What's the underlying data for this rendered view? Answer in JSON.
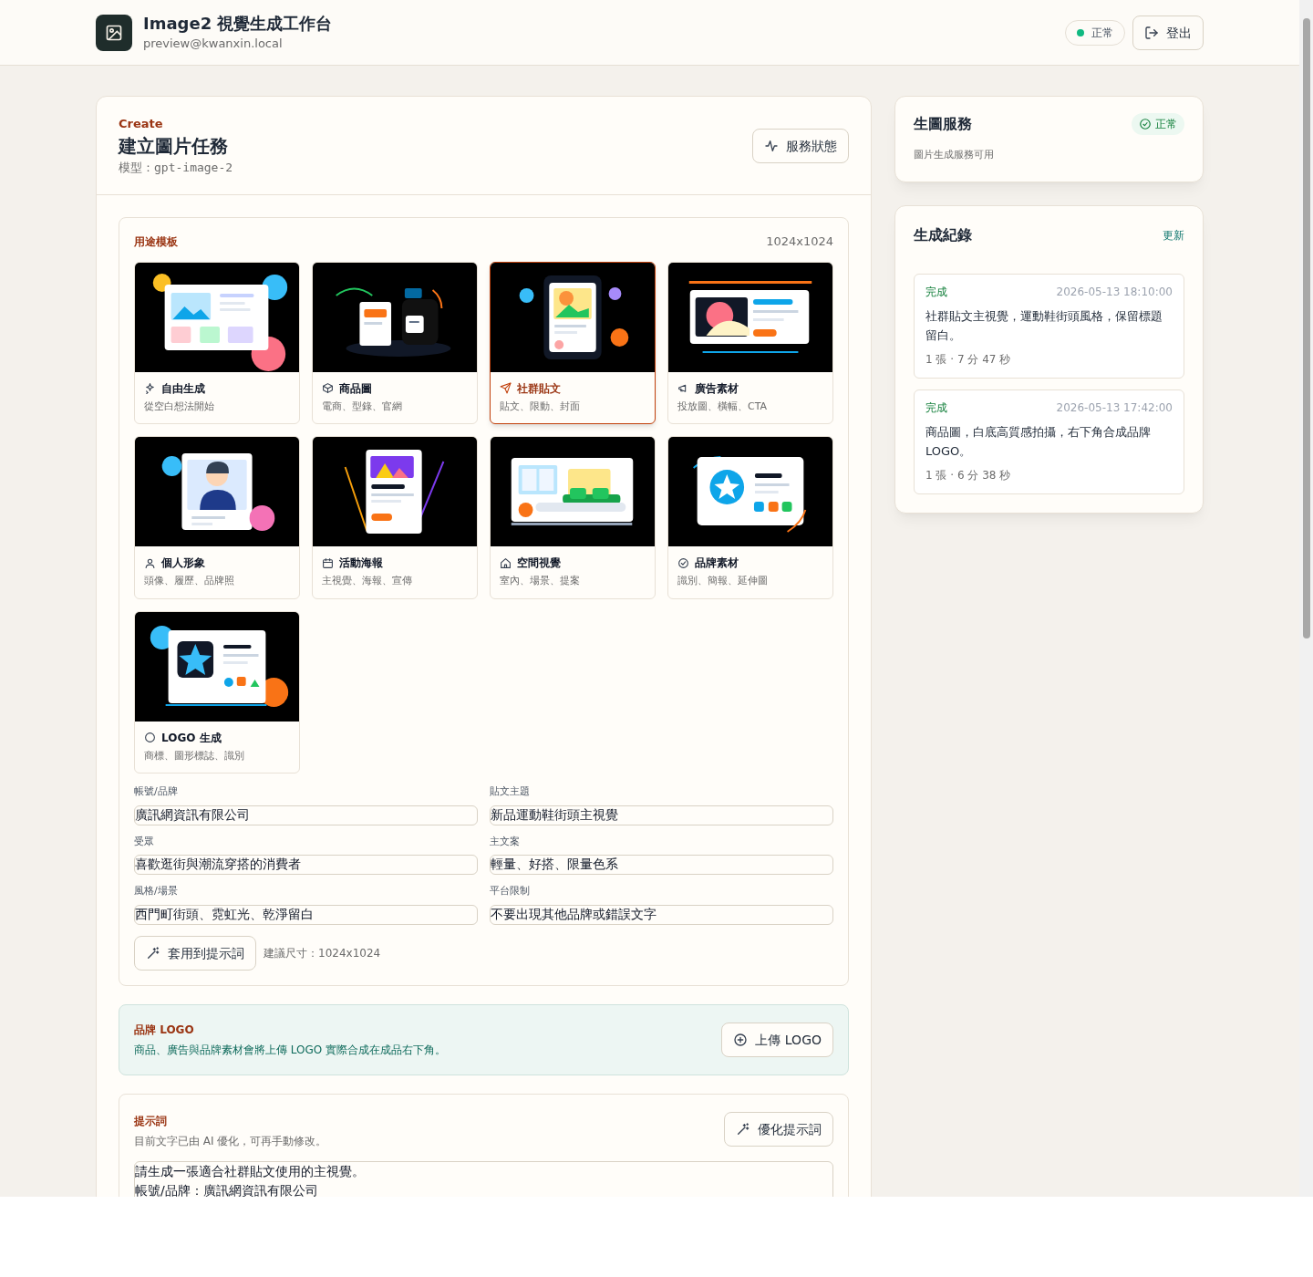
{
  "header": {
    "title": "Image2 視覺生成工作台",
    "email": "preview@kwanxin.local",
    "status": "正常",
    "logout": "登出"
  },
  "create": {
    "eyebrow": "Create",
    "title": "建立圖片任務",
    "model_label": "模型：",
    "model": "gpt-image-2",
    "status_button": "服務狀態"
  },
  "templates": {
    "title": "用途模板",
    "size": "1024x1024",
    "items": [
      {
        "kind": "free",
        "title": "自由生成",
        "subtitle": "從空白想法開始",
        "selected": false
      },
      {
        "kind": "product",
        "title": "商品圖",
        "subtitle": "電商、型錄、官網",
        "selected": false
      },
      {
        "kind": "social",
        "title": "社群貼文",
        "subtitle": "貼文、限動、封面",
        "selected": true
      },
      {
        "kind": "ad",
        "title": "廣告素材",
        "subtitle": "投放圖、橫幅、CTA",
        "selected": false
      },
      {
        "kind": "portrait",
        "title": "個人形象",
        "subtitle": "頭像、履歷、品牌照",
        "selected": false
      },
      {
        "kind": "poster",
        "title": "活動海報",
        "subtitle": "主視覺、海報、宣傳",
        "selected": false
      },
      {
        "kind": "space",
        "title": "空間視覺",
        "subtitle": "室內、場景、提案",
        "selected": false
      },
      {
        "kind": "brand",
        "title": "品牌素材",
        "subtitle": "識別、簡報、延伸圖",
        "selected": false
      },
      {
        "kind": "logo",
        "title": "LOGO 生成",
        "subtitle": "商標、圖形標誌、識別",
        "selected": false
      }
    ]
  },
  "fields": [
    {
      "label": "帳號/品牌",
      "value": "廣訊網資訊有限公司"
    },
    {
      "label": "貼文主題",
      "value": "新品運動鞋街頭主視覺"
    },
    {
      "label": "受眾",
      "value": "喜歡逛街與潮流穿搭的消費者"
    },
    {
      "label": "主文案",
      "value": "輕量、好搭、限量色系"
    },
    {
      "label": "風格/場景",
      "value": "西門町街頭、霓虹光、乾淨留白"
    },
    {
      "label": "平台限制",
      "value": "不要出現其他品牌或錯誤文字"
    }
  ],
  "apply_button": "套用到提示詞",
  "suggested_size": "建議尺寸：1024x1024",
  "brand_logo": {
    "title": "品牌 LOGO",
    "description": "商品、廣告與品牌素材會將上傳 LOGO 實際合成在成品右下角。",
    "button": "上傳 LOGO"
  },
  "prompt": {
    "title": "提示詞",
    "note": "目前文字已由 AI 優化，可再手動修改。",
    "button": "優化提示詞",
    "lines": [
      "請生成一張適合社群貼文使用的主視覺。",
      "帳號/品牌：廣訊網資訊有限公司"
    ]
  },
  "service": {
    "title": "生圖服務",
    "status": "正常",
    "description": "圖片生成服務可用"
  },
  "history": {
    "title": "生成紀錄",
    "refresh": "更新",
    "items": [
      {
        "status": "完成",
        "time": "2026-05-13 18:10:00",
        "text": "社群貼文主視覺，運動鞋街頭風格，保留標題留白。",
        "meta": "1 張 · 7 分 47 秒"
      },
      {
        "status": "完成",
        "time": "2026-05-13 17:42:00",
        "text": "商品圖，白底高質感拍攝，右下角合成品牌 LOGO。",
        "meta": "1 張 · 6 分 38 秒"
      }
    ]
  }
}
